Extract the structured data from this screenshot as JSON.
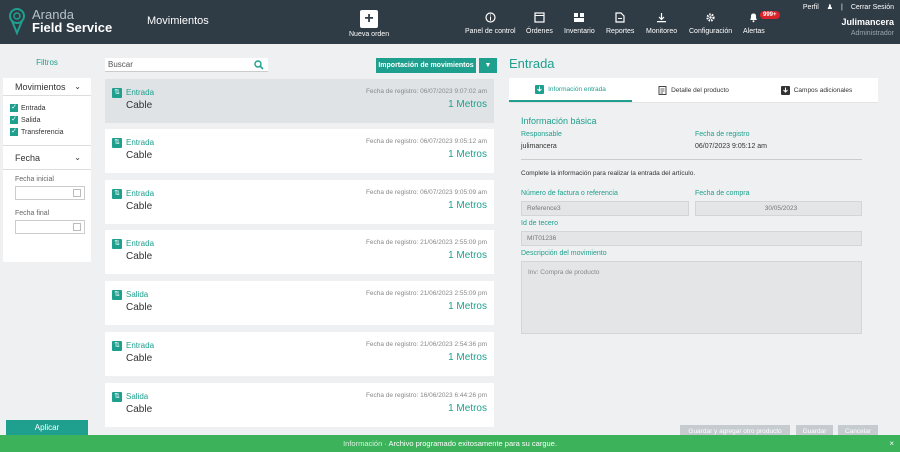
{
  "header": {
    "logo_line1": "Aranda",
    "logo_line2": "Field Service",
    "page_title": "Movimientos",
    "new_order_label": "Nueva orden",
    "nav": [
      {
        "label": "Panel de control",
        "icon": "info-icon"
      },
      {
        "label": "Órdenes",
        "icon": "orders-icon"
      },
      {
        "label": "Inventario",
        "icon": "inventory-icon"
      },
      {
        "label": "Reportes",
        "icon": "reports-icon"
      },
      {
        "label": "Monitoreo",
        "icon": "monitor-icon"
      },
      {
        "label": "Configuración",
        "icon": "gear-icon"
      },
      {
        "label": "Alertas",
        "icon": "bell-icon"
      }
    ],
    "alerts_badge": "999+",
    "profile_link": "Perfil",
    "logout_link": "Cerrar Sesión",
    "user_name": "Julimancera",
    "user_role": "Administrador"
  },
  "filters": {
    "title": "Filtros",
    "movements_heading": "Movimientos",
    "checks": [
      "Entrada",
      "Salida",
      "Transferencia"
    ],
    "date_heading": "Fecha",
    "date_start_label": "Fecha inicial",
    "date_end_label": "Fecha final",
    "apply_label": "Aplicar"
  },
  "list": {
    "search_placeholder": "Buscar",
    "import_label": "Importación de movimientos",
    "items": [
      {
        "type": "Entrada",
        "name": "Cable",
        "date": "Fecha de registro: 06/07/2023 9:07:02 am",
        "qty": "1 Metros"
      },
      {
        "type": "Entrada",
        "name": "Cable",
        "date": "Fecha de registro: 06/07/2023 9:05:12 am",
        "qty": "1 Metros"
      },
      {
        "type": "Entrada",
        "name": "Cable",
        "date": "Fecha de registro: 06/07/2023 9:05:09 am",
        "qty": "1 Metros"
      },
      {
        "type": "Entrada",
        "name": "Cable",
        "date": "Fecha de registro: 21/06/2023 2:55:09 pm",
        "qty": "1 Metros"
      },
      {
        "type": "Salida",
        "name": "Cable",
        "date": "Fecha de registro: 21/06/2023 2:55:09 pm",
        "qty": "1 Metros"
      },
      {
        "type": "Entrada",
        "name": "Cable",
        "date": "Fecha de registro: 21/06/2023 2:54:36 pm",
        "qty": "1 Metros"
      },
      {
        "type": "Salida",
        "name": "Cable",
        "date": "Fecha de registro: 16/06/2023 6:44:26 pm",
        "qty": "1 Metros"
      }
    ]
  },
  "detail": {
    "title": "Entrada",
    "tabs": [
      "Información entrada",
      "Detalle del producto",
      "Campos adicionales"
    ],
    "section_title": "Información básica",
    "responsible_label": "Responsable",
    "responsible_value": "julimancera",
    "registered_label": "Fecha de registro",
    "registered_value": "06/07/2023 9:05:12 am",
    "hint": "Complete la información para realizar la entrada del artículo.",
    "invoice_label": "Número de factura o referencia",
    "invoice_value": "Reference3",
    "purchase_date_label": "Fecha de compra",
    "purchase_date_value": "30/05/2023",
    "third_party_label": "Id de tecero",
    "third_party_value": "MIT01236",
    "description_label": "Descripción del movimiento",
    "description_value": "Inv: Compra de producto"
  },
  "actions": {
    "save_add_label": "Guardar y agregar otro producto",
    "save_label": "Guardar",
    "cancel_label": "Cancelar"
  },
  "info_bar": {
    "prefix": "Información · ",
    "message": "Archivo programado exitosamente para su cargue.",
    "close": "×"
  },
  "colors": {
    "accent": "#1fa08e",
    "header_bg": "#2f3b45",
    "success_bar": "#3cb25a",
    "badge": "#d9222a"
  }
}
